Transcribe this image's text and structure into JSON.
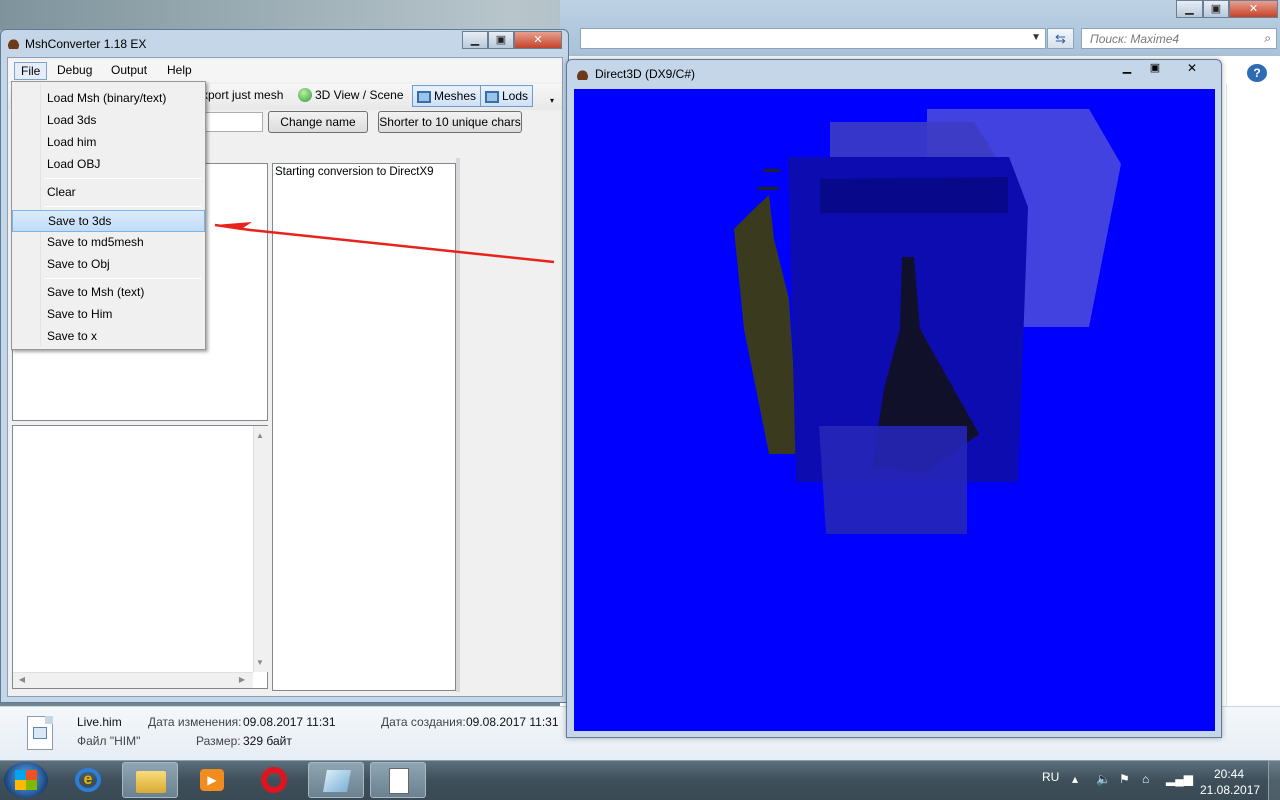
{
  "explorer": {
    "search_placeholder": "Поиск: Maxime4",
    "details": {
      "filename": "Live.him",
      "filetype": "Файл \"HIM\"",
      "modified_label": "Дата изменения:",
      "modified_value": "09.08.2017 11:31",
      "size_label": "Размер:",
      "size_value": "329 байт",
      "created_label": "Дата создания:",
      "created_value": "09.08.2017 11:31"
    }
  },
  "msh": {
    "title": "MshConverter 1.18 EX",
    "menu": [
      "File",
      "Debug",
      "Output",
      "Help"
    ],
    "toolbar": {
      "export_mesh": "xport just mesh",
      "view_scene": "3D View / Scene",
      "meshes": "Meshes",
      "lods": "Lods"
    },
    "change_name": "Change name",
    "shorter": "Shorter to 10 unique chars",
    "log_line": "Starting conversion to DirectX9",
    "file_menu": {
      "load_msh": "Load Msh (binary/text)",
      "load_3ds": "Load 3ds",
      "load_him": "Load him",
      "load_obj": "Load OBJ",
      "clear": "Clear",
      "save_3ds": "Save to 3ds",
      "save_md5": "Save to md5mesh",
      "save_obj": "Save to Obj",
      "save_msh": "Save to Msh (text)",
      "save_him": "Save to Him",
      "save_x": "Save to x"
    }
  },
  "d3d": {
    "title": "Direct3D (DX9/C#)",
    "viewport_color": "#0000ff"
  },
  "taskbar": {
    "lang": "RU",
    "time": "20:44",
    "date": "21.08.2017"
  },
  "colors": {
    "annotation_arrow": "#e8231c",
    "menu_highlight": "#c1dcf6"
  }
}
